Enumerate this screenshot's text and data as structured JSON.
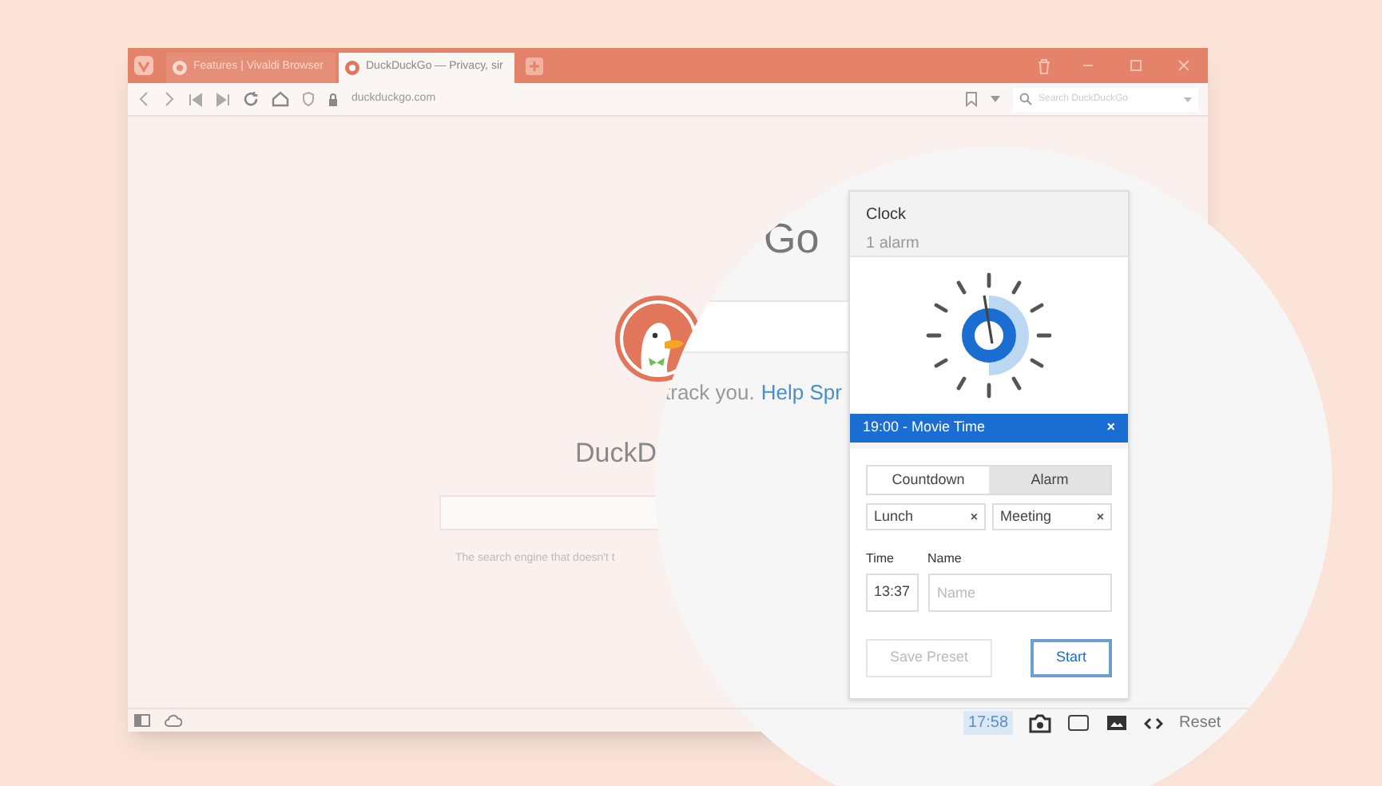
{
  "browser": {
    "tabs": [
      {
        "label": "Features | Vivaldi Browser",
        "selected": false
      },
      {
        "label": "DuckDuckGo — Privacy, sir",
        "selected": true
      }
    ],
    "address": "duckduckgo.com",
    "search": {
      "placeholder": "Search DuckDuckGo"
    }
  },
  "page": {
    "logo_text": "DuckD",
    "tagline": "The search engine that doesn't t"
  },
  "magnified": {
    "logo_text": "Go",
    "tagline": "track you.",
    "link": "Help Spr"
  },
  "clock_panel": {
    "title": "Clock",
    "subtitle": "1 alarm",
    "alarm": {
      "label": "19:00 - Movie Time",
      "close": "×"
    },
    "modes": [
      {
        "label": "Countdown",
        "selected": false
      },
      {
        "label": "Alarm",
        "selected": true
      }
    ],
    "presets": [
      {
        "label": "Lunch",
        "close": "×"
      },
      {
        "label": "Meeting",
        "close": "×"
      }
    ],
    "time": {
      "label": "Time",
      "value": "13:37"
    },
    "name": {
      "label": "Name",
      "placeholder": "Name"
    },
    "buttons": [
      {
        "label": "Save Preset",
        "disabled": true
      },
      {
        "label": "Start",
        "disabled": false
      }
    ]
  },
  "status_bar": {
    "clock": "17:58",
    "reset": "Reset"
  }
}
